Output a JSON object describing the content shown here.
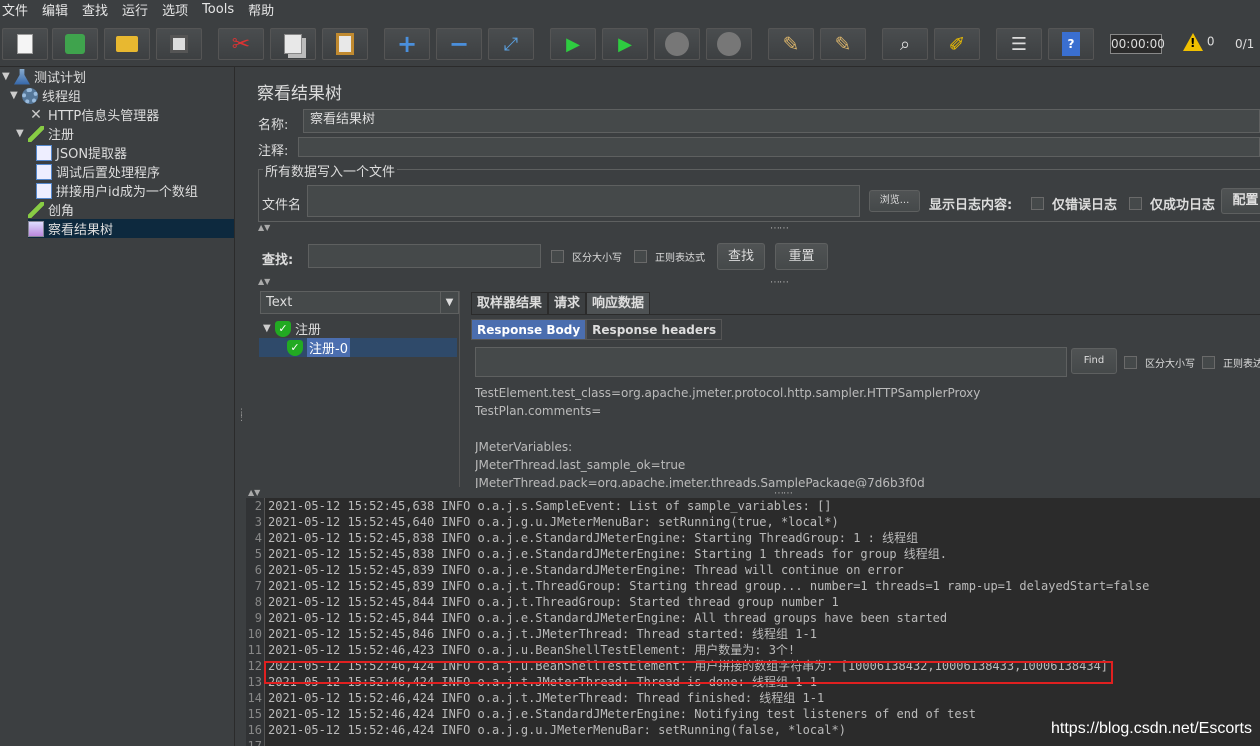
{
  "menu": [
    "文件",
    "编辑",
    "查找",
    "运行",
    "选项",
    "Tools",
    "帮助"
  ],
  "toolbar": {
    "timer": "00:00:00",
    "warnings": "0",
    "ratio": "0/1"
  },
  "tree": [
    {
      "label": "测试计划",
      "icon": "flask-icon"
    },
    {
      "label": "线程组",
      "icon": "gear-icon"
    },
    {
      "label": "HTTP信息头管理器",
      "icon": "wrench-icon"
    },
    {
      "label": "注册",
      "icon": "pipette-icon"
    },
    {
      "label": "JSON提取器",
      "icon": "doc-icon"
    },
    {
      "label": "调试后置处理程序",
      "icon": "doc-icon"
    },
    {
      "label": "拼接用户id成为一个数组",
      "icon": "doc-icon"
    },
    {
      "label": "创角",
      "icon": "pipette-icon"
    },
    {
      "label": "察看结果树",
      "icon": "chart-icon"
    }
  ],
  "panel": {
    "title": "察看结果树",
    "name_label": "名称:",
    "name_value": "察看结果树",
    "comment_label": "注释:",
    "section_title": "所有数据写入一个文件",
    "file_label": "文件名",
    "browse": "浏览...",
    "log_label": "显示日志内容:",
    "errors_only": "仅错误日志",
    "success_only": "仅成功日志",
    "configure": "配置"
  },
  "search": {
    "label": "查找:",
    "case": "区分大小写",
    "regex": "正则表达式",
    "find": "查找",
    "reset": "重置"
  },
  "results": {
    "renderer": "Text",
    "nodes": [
      {
        "label": "注册"
      },
      {
        "label": "注册-0"
      }
    ],
    "tabs": [
      "取样器结果",
      "请求",
      "响应数据"
    ],
    "subtabs": [
      "Response Body",
      "Response headers"
    ],
    "find": "Find",
    "case": "区分大小写",
    "regex": "正则表达",
    "body": [
      "TestElement.test_class=org.apache.jmeter.protocol.http.sampler.HTTPSamplerProxy",
      "TestPlan.comments=",
      "",
      "JMeterVariables:",
      "JMeterThread.last_sample_ok=true",
      "JMeterThread.pack=org.apache.jmeter.threads.SamplePackage@7d6b3f0d"
    ]
  },
  "log": [
    {
      "n": "2",
      "t": "2021-05-12 15:52:45,638 INFO o.a.j.s.SampleEvent: List of sample_variables: []"
    },
    {
      "n": "3",
      "t": "2021-05-12 15:52:45,640 INFO o.a.j.g.u.JMeterMenuBar: setRunning(true, *local*)"
    },
    {
      "n": "4",
      "t": "2021-05-12 15:52:45,838 INFO o.a.j.e.StandardJMeterEngine: Starting ThreadGroup: 1 : 线程组"
    },
    {
      "n": "5",
      "t": "2021-05-12 15:52:45,838 INFO o.a.j.e.StandardJMeterEngine: Starting 1 threads for group 线程组."
    },
    {
      "n": "6",
      "t": "2021-05-12 15:52:45,839 INFO o.a.j.e.StandardJMeterEngine: Thread will continue on error"
    },
    {
      "n": "7",
      "t": "2021-05-12 15:52:45,839 INFO o.a.j.t.ThreadGroup: Starting thread group... number=1 threads=1 ramp-up=1 delayedStart=false"
    },
    {
      "n": "8",
      "t": "2021-05-12 15:52:45,844 INFO o.a.j.t.ThreadGroup: Started thread group number 1"
    },
    {
      "n": "9",
      "t": "2021-05-12 15:52:45,844 INFO o.a.j.e.StandardJMeterEngine: All thread groups have been started"
    },
    {
      "n": "10",
      "t": "2021-05-12 15:52:45,846 INFO o.a.j.t.JMeterThread: Thread started: 线程组 1-1"
    },
    {
      "n": "11",
      "t": "2021-05-12 15:52:46,423 INFO o.a.j.u.BeanShellTestElement: 用户数量为: 3个!"
    },
    {
      "n": "12",
      "t": "2021-05-12 15:52:46,424 INFO o.a.j.u.BeanShellTestElement: 用户拼接的数组字符串为: [10006138432,10006138433,10006138434]"
    },
    {
      "n": "13",
      "t": "2021-05-12 15:52:46,424 INFO o.a.j.t.JMeterThread: Thread is done: 线程组 1-1"
    },
    {
      "n": "14",
      "t": "2021-05-12 15:52:46,424 INFO o.a.j.t.JMeterThread: Thread finished: 线程组 1-1"
    },
    {
      "n": "15",
      "t": "2021-05-12 15:52:46,424 INFO o.a.j.e.StandardJMeterEngine: Notifying test listeners of end of test"
    },
    {
      "n": "16",
      "t": "2021-05-12 15:52:46,424 INFO o.a.j.g.u.JMeterMenuBar: setRunning(false, *local*)"
    },
    {
      "n": "17",
      "t": ""
    }
  ],
  "watermark": "https://blog.csdn.net/Escorts"
}
